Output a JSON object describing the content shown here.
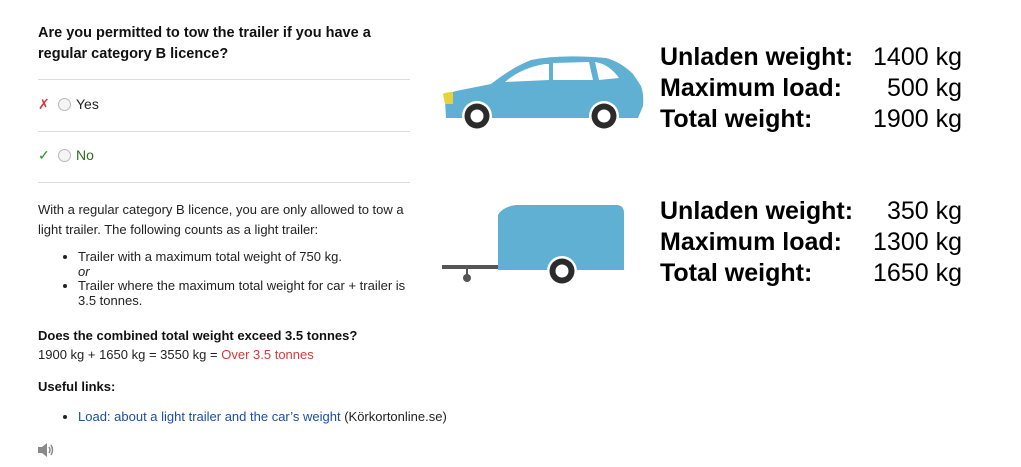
{
  "question": "Are you permitted to tow the trailer if you have a regular category B licence?",
  "options": [
    {
      "mark": "✗",
      "label": "Yes",
      "correct": false
    },
    {
      "mark": "✓",
      "label": "No",
      "correct": true
    }
  ],
  "explanation": "With a regular category B licence, you are only allowed to tow a light trailer. The following counts as a light trailer:",
  "bullets": [
    "Trailer with a maximum total weight of 750 kg.",
    "Trailer where the maximum total weight for car + trailer is 3.5 tonnes."
  ],
  "or_text": "or",
  "combined_heading": "Does the combined total weight exceed 3.5 tonnes?",
  "calc_text": "1900 kg + 1650 kg = 3550 kg = ",
  "calc_result": "Over 3.5 tonnes",
  "links_heading": "Useful links:",
  "link_text": "Load: about a light trailer and the car’s weight",
  "link_source": "(Körkortonline.se)",
  "car": {
    "color": "#5fb0d3",
    "rows": [
      {
        "label": "Unladen weight:",
        "value": "1400 kg"
      },
      {
        "label": "Maximum load:",
        "value": "500 kg"
      },
      {
        "label": "Total weight:",
        "value": "1900 kg"
      }
    ]
  },
  "trailer": {
    "color": "#5fb0d3",
    "rows": [
      {
        "label": "Unladen weight:",
        "value": "350 kg"
      },
      {
        "label": "Maximum load:",
        "value": "1300 kg"
      },
      {
        "label": "Total weight:",
        "value": "1650 kg"
      }
    ]
  },
  "icons": {
    "speaker": "speaker-icon",
    "car": "car-icon",
    "trailer": "trailer-icon"
  }
}
